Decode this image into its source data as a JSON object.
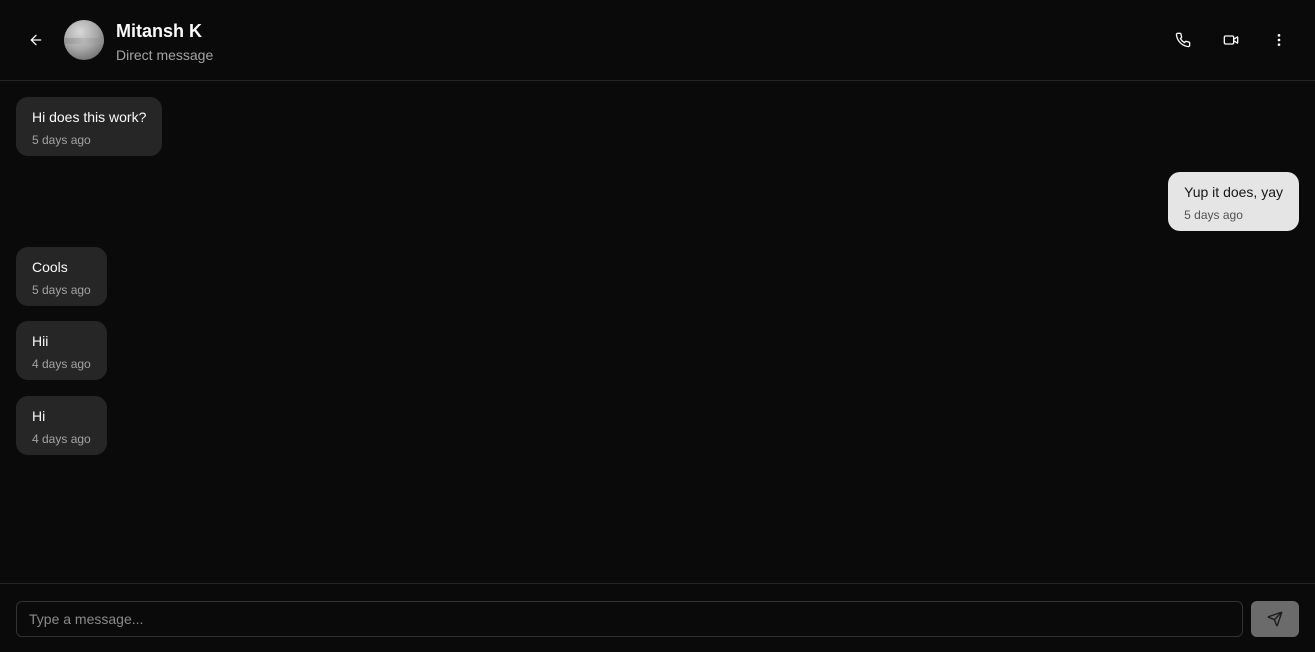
{
  "header": {
    "name": "Mitansh K",
    "subtitle": "Direct message"
  },
  "icons": {
    "back": "arrow-left-icon",
    "call": "phone-icon",
    "video": "video-icon",
    "more": "more-vertical-icon",
    "send": "send-icon"
  },
  "messages": [
    {
      "text": "Hi does this work?",
      "time": "5 days ago",
      "direction": "incoming"
    },
    {
      "text": "Yup it does, yay",
      "time": "5 days ago",
      "direction": "outgoing"
    },
    {
      "text": "Cools",
      "time": "5 days ago",
      "direction": "incoming"
    },
    {
      "text": "Hii",
      "time": "4 days ago",
      "direction": "incoming"
    },
    {
      "text": "Hi",
      "time": "4 days ago",
      "direction": "incoming"
    }
  ],
  "composer": {
    "placeholder": "Type a message...",
    "value": ""
  },
  "colors": {
    "background": "#0a0a0a",
    "incoming_bubble": "#262626",
    "outgoing_bubble": "#e5e5e5",
    "send_button": "#6b6b6b"
  }
}
